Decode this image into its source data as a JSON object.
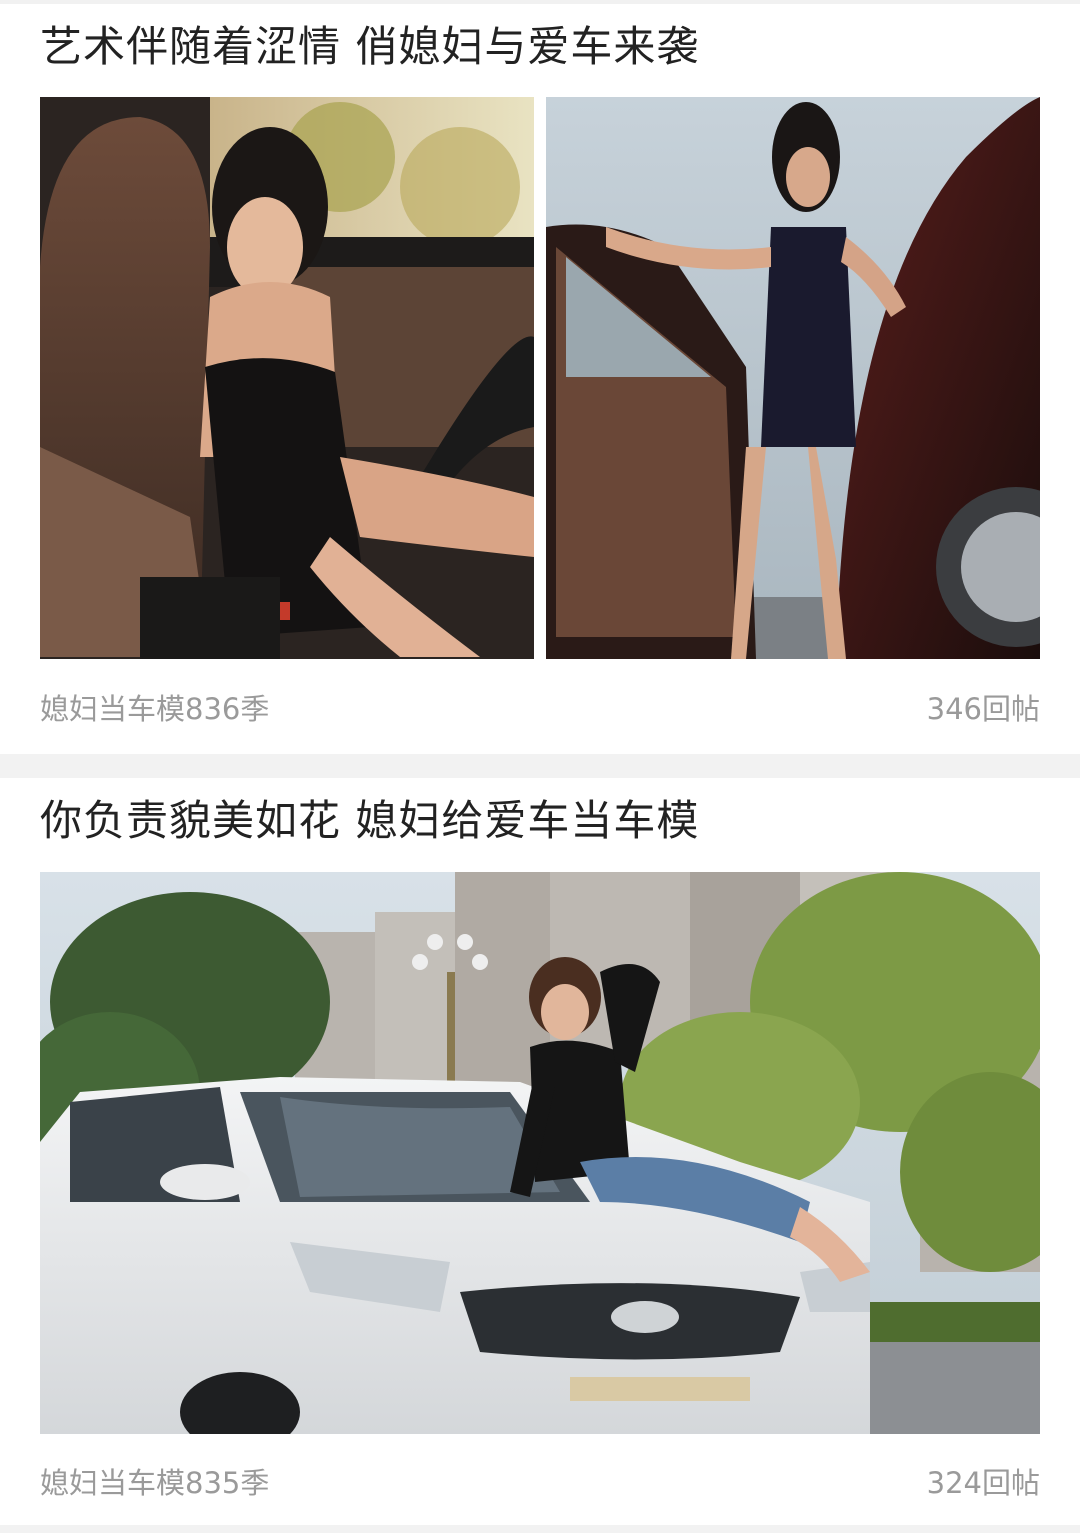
{
  "posts": [
    {
      "title": "艺术伴随着涩情 俏媳妇与爱车来袭",
      "author": "媳妇当车模836季",
      "replies": "346回帖",
      "images": [
        "photo-woman-in-car-seat",
        "photo-woman-at-car-door"
      ]
    },
    {
      "title": "你负责貌美如花 媳妇给爱车当车模",
      "author": "媳妇当车模835季",
      "replies": "324回帖",
      "images": [
        "photo-woman-on-white-suv"
      ]
    }
  ],
  "colors": {
    "title": "#222222",
    "meta": "#9a9a9a",
    "separator": "#f2f2f2"
  }
}
